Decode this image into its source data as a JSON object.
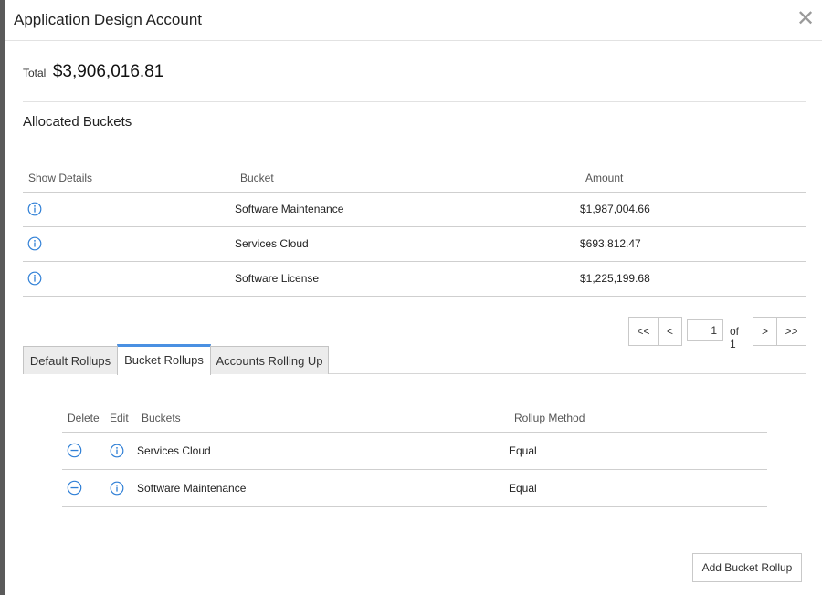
{
  "modal": {
    "title": "Application Design Account",
    "close_symbol": "✕"
  },
  "total": {
    "label": "Total",
    "value": "$3,906,016.81"
  },
  "allocated": {
    "title": "Allocated Buckets",
    "columns": [
      "Show Details",
      "Bucket",
      "Amount"
    ],
    "rows": [
      {
        "bucket": "Software Maintenance",
        "amount": "$1,987,004.66"
      },
      {
        "bucket": "Services Cloud",
        "amount": "$693,812.47"
      },
      {
        "bucket": "Software License",
        "amount": "$1,225,199.68"
      }
    ]
  },
  "pager": {
    "first": "<<",
    "prev": "<",
    "page": "1",
    "of": "of 1",
    "next": ">",
    "last": ">>"
  },
  "tabs": [
    {
      "label": "Default Rollups",
      "active": false
    },
    {
      "label": "Bucket Rollups",
      "active": true
    },
    {
      "label": "Accounts Rolling Up",
      "active": false
    }
  ],
  "rollups": {
    "columns": [
      "Delete",
      "Edit",
      "Buckets",
      "Rollup Method"
    ],
    "rows": [
      {
        "bucket": "Services Cloud",
        "method": "Equal"
      },
      {
        "bucket": "Software Maintenance",
        "method": "Equal"
      }
    ]
  },
  "add_button": "Add Bucket Rollup",
  "colors": {
    "accent": "#4a90e2",
    "icon_blue": "#2f7fd6"
  }
}
